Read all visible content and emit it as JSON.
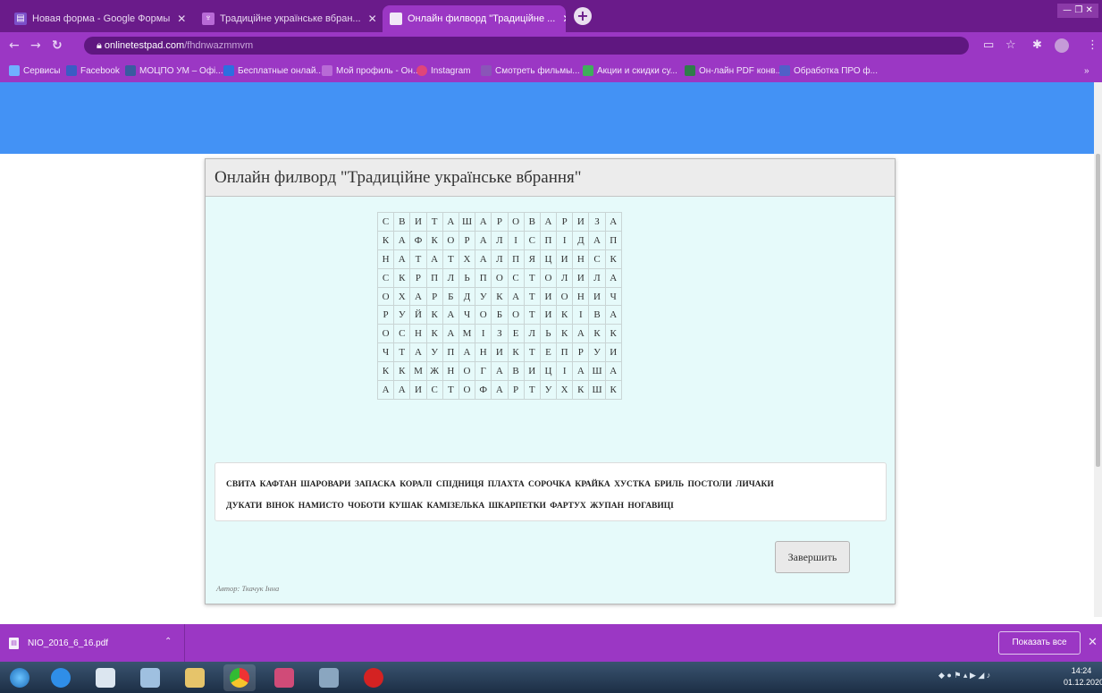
{
  "browser": {
    "tabs": [
      {
        "title": "Новая форма - Google Формы",
        "active": false
      },
      {
        "title": "Традиційне українське вбран...",
        "active": false
      },
      {
        "title": "Онлайн филворд \"Традиційне ...",
        "active": true
      }
    ],
    "new_tab": "+",
    "window_controls": "— ❐ ✕",
    "url_host": "onlinetestpad.com",
    "url_path": "/fhdnwazmmvm",
    "bookmarks": [
      "Сервисы",
      "Facebook",
      "МОЦПО УМ – Офі...",
      "Бесплатные онлай...",
      "Мой профиль - Он...",
      "Instagram",
      "Смотреть фильмы...",
      "Акции и скидки су...",
      "Он-лайн PDF конв...",
      "Обработка ПРО ф..."
    ]
  },
  "page": {
    "title": "Онлайн филворд \"Традиційне українське вбрання\"",
    "grid": [
      [
        "С",
        "В",
        "И",
        "Т",
        "А",
        "Ш",
        "А",
        "Р",
        "О",
        "В",
        "А",
        "Р",
        "И",
        "З",
        "А"
      ],
      [
        "К",
        "А",
        "Ф",
        "К",
        "О",
        "Р",
        "А",
        "Л",
        "І",
        "С",
        "П",
        "І",
        "Д",
        "А",
        "П"
      ],
      [
        "Н",
        "А",
        "Т",
        "А",
        "Т",
        "Х",
        "А",
        "Л",
        "П",
        "Я",
        "Ц",
        "И",
        "Н",
        "С",
        "К"
      ],
      [
        "С",
        "К",
        "Р",
        "П",
        "Л",
        "Ь",
        "П",
        "О",
        "С",
        "Т",
        "О",
        "Л",
        "И",
        "Л",
        "А"
      ],
      [
        "О",
        "Х",
        "А",
        "Р",
        "Б",
        "Д",
        "У",
        "К",
        "А",
        "Т",
        "И",
        "О",
        "Н",
        "И",
        "Ч"
      ],
      [
        "Р",
        "У",
        "Й",
        "К",
        "А",
        "Ч",
        "О",
        "Б",
        "О",
        "Т",
        "И",
        "К",
        "І",
        "В",
        "А"
      ],
      [
        "О",
        "С",
        "Н",
        "К",
        "А",
        "М",
        "І",
        "З",
        "Е",
        "Л",
        "Ь",
        "К",
        "А",
        "К",
        "К"
      ],
      [
        "Ч",
        "Т",
        "А",
        "У",
        "П",
        "А",
        "Н",
        "И",
        "К",
        "Т",
        "Е",
        "П",
        "Р",
        "У",
        "И"
      ],
      [
        "К",
        "К",
        "М",
        "Ж",
        "Н",
        "О",
        "Г",
        "А",
        "В",
        "И",
        "Ц",
        "І",
        "А",
        "Ш",
        "А"
      ],
      [
        "А",
        "А",
        "И",
        "С",
        "Т",
        "О",
        "Ф",
        "А",
        "Р",
        "Т",
        "У",
        "Х",
        "К",
        "Ш",
        "К"
      ]
    ],
    "words_line1": "СВИТА КАФТАН ШАРОВАРИ ЗАПАСКА КОРАЛІ СПІДНИЦЯ ПЛАХТА СОРОЧКА КРАЙКА ХУСТКА БРИЛЬ ПОСТОЛИ ЛИЧАКИ",
    "words_line2": "ДУКАТИ ВІНОК НАМИСТО ЧОБОТИ КУШАК КАМІЗЕЛЬКА ШКАРПЕТКИ ФАРТУХ ЖУПАН НОГАВИЦІ",
    "finish_button": "Завершить",
    "author": "Автор: Ткачук Інна"
  },
  "downloads": {
    "file_name": "NIO_2016_6_16.pdf",
    "show_all": "Показать все"
  },
  "taskbar": {
    "time": "14:24",
    "date": "01.12.2020"
  },
  "colors": {
    "chrome_dark": "#6a1b8a",
    "chrome": "#9b37c4",
    "page_band": "#4392f5",
    "card_bg": "#e6fafa"
  }
}
